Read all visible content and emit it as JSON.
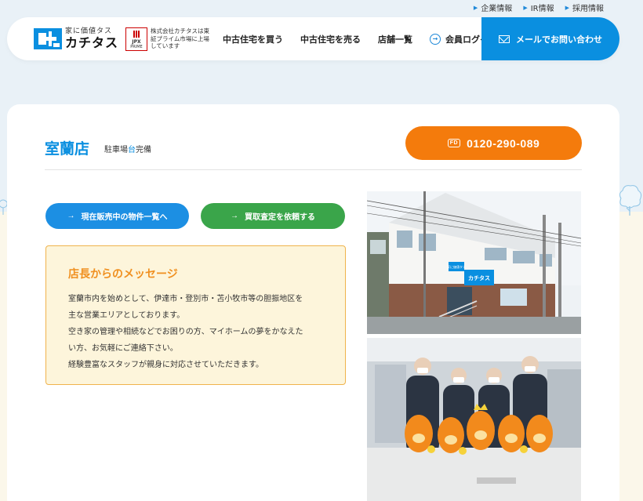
{
  "top_links": [
    {
      "label": "企業情報"
    },
    {
      "label": "IR情報"
    },
    {
      "label": "採用情報"
    }
  ],
  "header": {
    "logo_tagline": "家に価値タス",
    "logo_name": "カチタス",
    "jpx_label": "JPX",
    "jpx_sub": "PRIME",
    "listing_note": "株式会社カチタスは東証プライム市場に上場しています",
    "nav": [
      {
        "label": "中古住宅を買う"
      },
      {
        "label": "中古住宅を売る"
      },
      {
        "label": "店舗一覧"
      },
      {
        "label": "会員ログイン"
      }
    ],
    "contact_label": "メールでお問い合わせ"
  },
  "store": {
    "name": "室蘭店",
    "parking_pre": "駐車場",
    "parking_hl": "台",
    "parking_post": "完備",
    "phone_icon_text": "FD",
    "phone": "0120-290-089"
  },
  "buttons": {
    "listings": "現在販売中の物件一覧へ",
    "appraisal": "買取査定を依頼する"
  },
  "message": {
    "title": "店長からのメッセージ",
    "lines": [
      "室蘭市内を始めとして、伊達市・登別市・苫小牧市等の胆振地区を",
      "主な営業エリアとしております。",
      "空き家の管理や相続などでお困りの方、マイホームの夢をかなえた",
      "い方、お気軽にご連絡下さい。",
      "経験豊富なスタッフが親身に対応させていただきます。"
    ]
  },
  "photos": {
    "sign_text_top": "家に価値タス",
    "sign_text": "カチタス"
  },
  "colors": {
    "brand_blue": "#0a8fe0",
    "orange": "#f47b0c",
    "green": "#3aa54a",
    "background": "#e9f1f7",
    "cream": "#fbf7ea"
  }
}
